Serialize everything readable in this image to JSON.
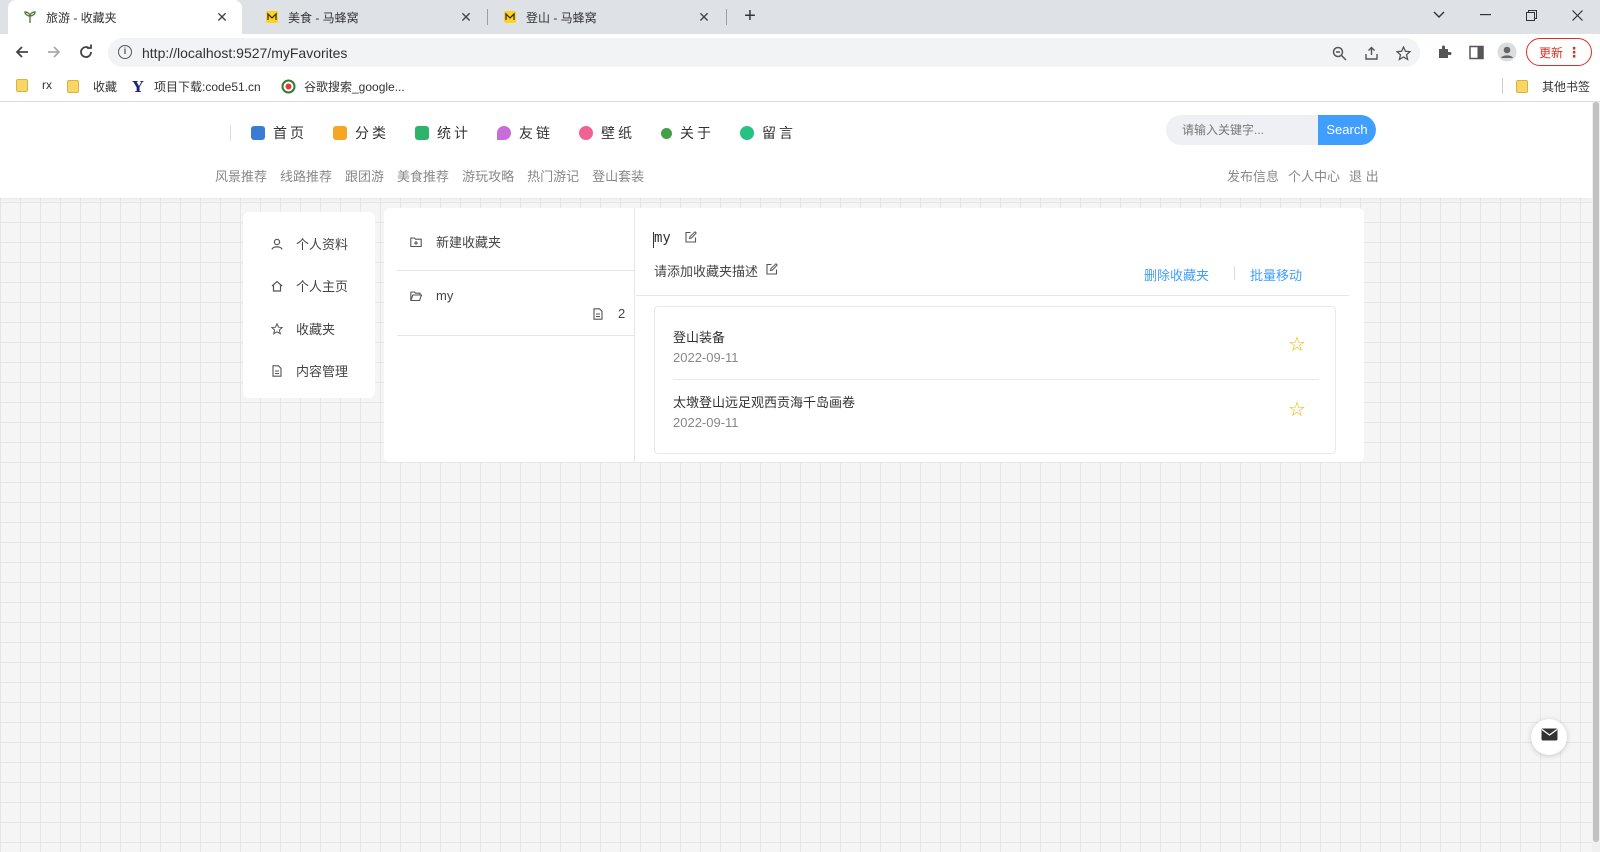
{
  "browser": {
    "tabs": [
      {
        "title": "旅游 - 收藏夹",
        "icon": "plant-icon"
      },
      {
        "title": "美食 - 马蜂窝",
        "icon": "mafengwo-icon"
      },
      {
        "title": "登山 - 马蜂窝",
        "icon": "mafengwo-icon"
      }
    ],
    "url": "http://localhost:9527/myFavorites",
    "update_label": "更新",
    "bookmarks": [
      {
        "label": "rx",
        "icon": "folder-icon"
      },
      {
        "label": "收藏",
        "icon": "folder-icon"
      },
      {
        "label": "项目下载:code51.cn",
        "icon": "y-logo-icon"
      },
      {
        "label": "谷歌搜索_google...",
        "icon": "360-icon"
      }
    ],
    "other_bookmarks": "其他书签"
  },
  "site": {
    "main_nav": [
      {
        "label": "首页",
        "color": "#3a7bd5"
      },
      {
        "label": "分类",
        "color": "#f5a623"
      },
      {
        "label": "统计",
        "color": "#2fb36b"
      },
      {
        "label": "友链",
        "color": "#c86dd7"
      },
      {
        "label": "壁纸",
        "color": "#f06292"
      },
      {
        "label": "关于",
        "color": "#43a047"
      },
      {
        "label": "留言",
        "color": "#26c281"
      }
    ],
    "search": {
      "placeholder": "请输入关键字...",
      "button": "Search"
    },
    "sub_nav": [
      "风景推荐",
      "线路推荐",
      "跟团游",
      "美食推荐",
      "游玩攻略",
      "热门游记",
      "登山套装"
    ],
    "user_nav": [
      "发布信息",
      "个人中心",
      "退 出"
    ]
  },
  "left_menu": [
    {
      "label": "个人资料",
      "icon": "user-icon"
    },
    {
      "label": "个人主页",
      "icon": "home-icon"
    },
    {
      "label": "收藏夹",
      "icon": "star-icon"
    },
    {
      "label": "内容管理",
      "icon": "document-icon"
    }
  ],
  "folders": {
    "new_label": "新建收藏夹",
    "items": [
      {
        "name": "my",
        "count": "2"
      }
    ]
  },
  "detail": {
    "name": "my",
    "description": "请添加收藏夹描述",
    "delete_label": "删除收藏夹",
    "move_label": "批量移动",
    "items": [
      {
        "title": "登山装备",
        "date": "2022-09-11"
      },
      {
        "title": "太墩登山远足观西贡海千岛画卷",
        "date": "2022-09-11"
      }
    ]
  }
}
